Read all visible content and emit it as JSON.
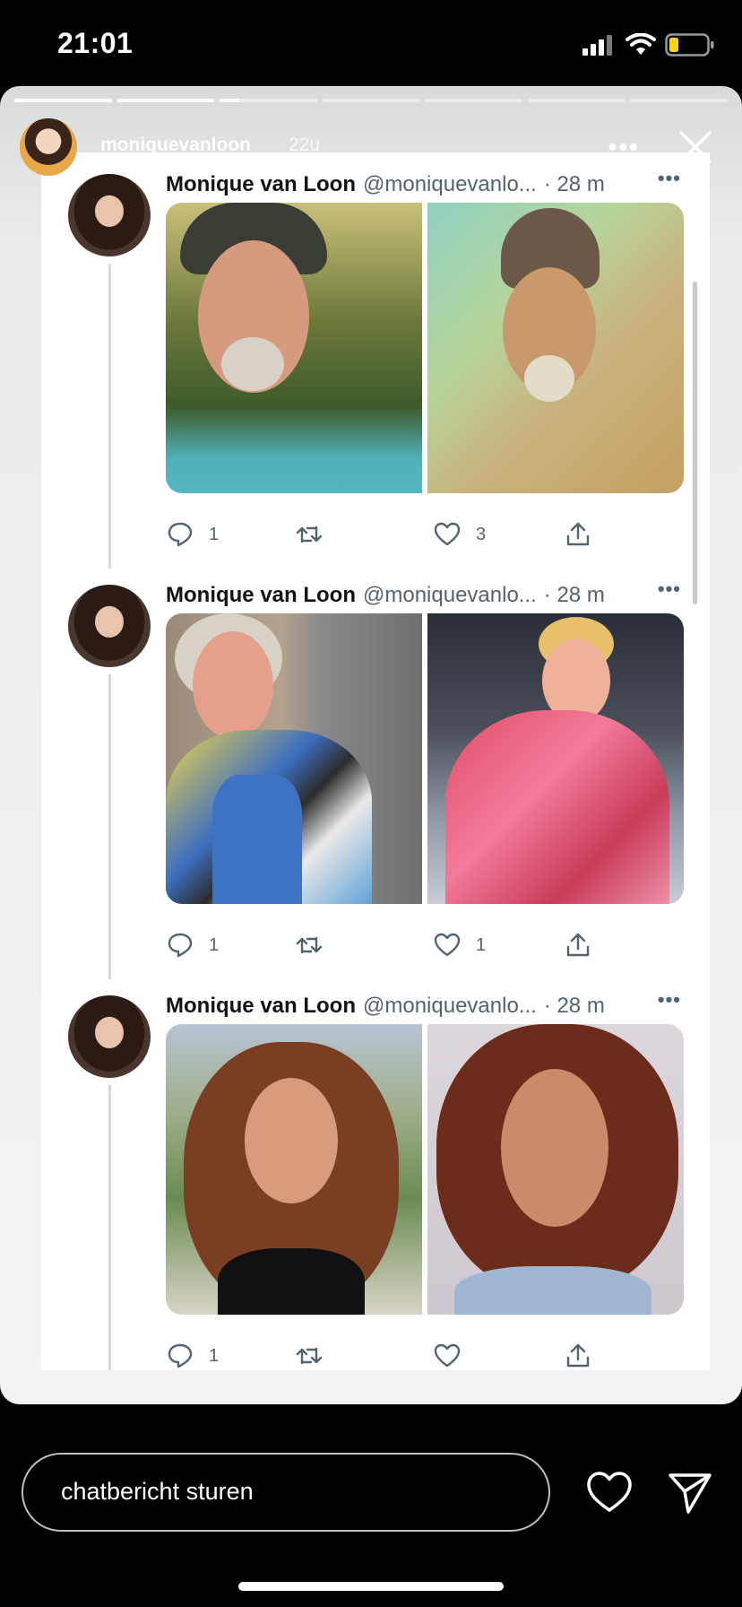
{
  "status_bar": {
    "time": "21:01",
    "battery_color": "#ffd60a",
    "icons": [
      "signal-icon",
      "wifi-icon",
      "battery-icon"
    ]
  },
  "story": {
    "username": "moniquevanloon",
    "time_ago": "22u",
    "progress_segments": [
      1,
      1,
      0.2,
      0,
      0,
      0,
      0
    ]
  },
  "tweets": [
    {
      "name": "Monique van Loon",
      "handle": "@moniquevanlo...",
      "time": "· 28 m",
      "reply_count": "1",
      "retweet_count": "",
      "like_count": "3"
    },
    {
      "name": "Monique van Loon",
      "handle": "@moniquevanlo...",
      "time": "· 28 m",
      "reply_count": "1",
      "retweet_count": "",
      "like_count": "1"
    },
    {
      "name": "Monique van Loon",
      "handle": "@moniquevanlo...",
      "time": "· 28 m",
      "reply_count": "1",
      "retweet_count": "",
      "like_count": ""
    }
  ],
  "reply": {
    "placeholder": "chatbericht sturen"
  },
  "colors": {
    "icon_gray": "#536471",
    "name_text": "#0f1419",
    "thread_line": "#cfd9de"
  }
}
